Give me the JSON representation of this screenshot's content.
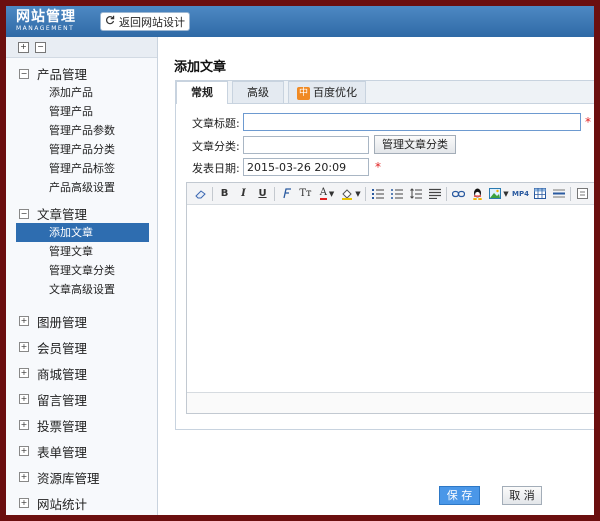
{
  "header": {
    "logo_cn": "网站管理",
    "logo_en": "MANAGEMENT",
    "back_button": "返回网站设计"
  },
  "sidebar": {
    "groups": [
      {
        "label": "产品管理",
        "toggle": "−",
        "items": [
          "添加产品",
          "管理产品",
          "管理产品参数",
          "管理产品分类",
          "管理产品标签",
          "产品高级设置"
        ]
      },
      {
        "label": "文章管理",
        "toggle": "−",
        "items": [
          "添加文章",
          "管理文章",
          "管理文章分类",
          "文章高级设置"
        ]
      },
      {
        "label": "图册管理",
        "toggle": "+"
      },
      {
        "label": "会员管理",
        "toggle": "+"
      },
      {
        "label": "商城管理",
        "toggle": "+"
      },
      {
        "label": "留言管理",
        "toggle": "+"
      },
      {
        "label": "投票管理",
        "toggle": "+"
      },
      {
        "label": "表单管理",
        "toggle": "+"
      },
      {
        "label": "资源库管理",
        "toggle": "+"
      },
      {
        "label": "网站统计",
        "toggle": "+"
      }
    ],
    "active_item": "添加文章"
  },
  "main": {
    "title": "添加文章",
    "tabs": [
      {
        "label": "常规",
        "active": true
      },
      {
        "label": "高级",
        "active": false
      },
      {
        "label": "百度优化",
        "badge": "中",
        "active": false
      }
    ],
    "form": {
      "title_label": "文章标题:",
      "title_value": "",
      "category_label": "文章分类:",
      "category_value": "",
      "manage_category_button": "管理文章分类",
      "date_label": "发表日期:",
      "date_value": "2015-03-26 20:09",
      "required_mark": "*"
    },
    "editor_toolbar": {
      "bold": "B",
      "italic": "I",
      "underline": "U",
      "font_size": "Tт",
      "font_color": "A",
      "mp4": "MP4"
    },
    "actions": {
      "save": "保 存",
      "cancel": "取 消"
    }
  },
  "colors": {
    "header_blue": "#3a78b6",
    "active_blue": "#2e6db0",
    "save_blue": "#4a97e8",
    "required_red": "#e02020",
    "outer_border": "#6b0f0f"
  }
}
